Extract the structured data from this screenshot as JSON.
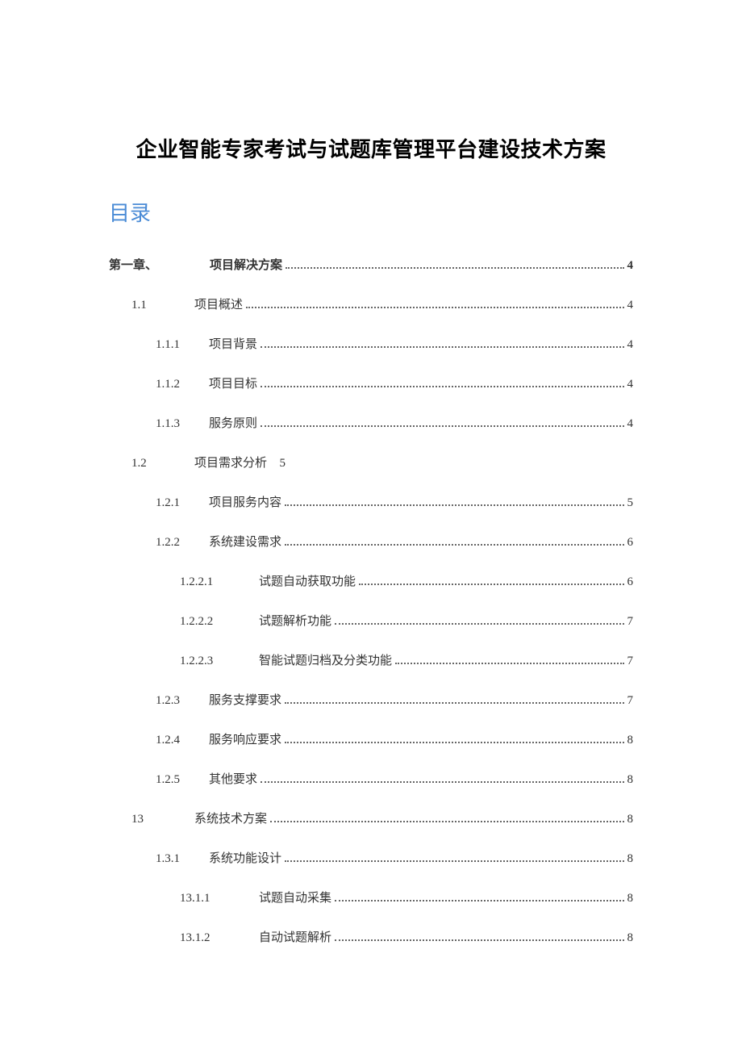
{
  "title": "企业智能专家考试与试题库管理平台建设技术方案",
  "toc_heading": "目录",
  "toc": [
    {
      "level": 1,
      "num": "第一章、",
      "label": "项目解决方案",
      "page": "4",
      "dots": true
    },
    {
      "level": 2,
      "num": "1.1",
      "label": "项目概述",
      "page": "4",
      "dots": true
    },
    {
      "level": 3,
      "num": "1.1.1",
      "label": "项目背景",
      "page": "4",
      "dots": true
    },
    {
      "level": 3,
      "num": "1.1.2",
      "label": "项目目标",
      "page": "4",
      "dots": true
    },
    {
      "level": 3,
      "num": "1.1.3",
      "label": "服务原则",
      "page": "4",
      "dots": true
    },
    {
      "level": 2,
      "num": "1.2",
      "label": "项目需求分析",
      "page": "5",
      "dots": false
    },
    {
      "level": 3,
      "num": "1.2.1",
      "label": "项目服务内容",
      "page": "5",
      "dots": true
    },
    {
      "level": 3,
      "num": "1.2.2",
      "label": "系统建设需求",
      "page": "6",
      "dots": true
    },
    {
      "level": 4,
      "num": "1.2.2.1",
      "label": "试题自动获取功能",
      "page": "6",
      "dots": true
    },
    {
      "level": 4,
      "num": "1.2.2.2",
      "label": "试题解析功能",
      "page": "7",
      "dots": true
    },
    {
      "level": 4,
      "num": "1.2.2.3",
      "label": "智能试题归档及分类功能",
      "page": "7",
      "dots": true
    },
    {
      "level": 3,
      "num": "1.2.3",
      "label": "服务支撑要求",
      "page": "7",
      "dots": true
    },
    {
      "level": 3,
      "num": "1.2.4",
      "label": "服务响应要求",
      "page": "8",
      "dots": true
    },
    {
      "level": 3,
      "num": "1.2.5",
      "label": "其他要求",
      "page": "8",
      "dots": true
    },
    {
      "level": 2,
      "num": "13",
      "label": "系统技术方案",
      "page": "8",
      "dots": true
    },
    {
      "level": 3,
      "num": "1.3.1",
      "label": "系统功能设计",
      "page": "8",
      "dots": true
    },
    {
      "level": 4,
      "num": "13.1.1",
      "label": "试题自动采集",
      "page": "8",
      "dots": true
    },
    {
      "level": 4,
      "num": "13.1.2",
      "label": "自动试题解析",
      "page": "8",
      "dots": true
    }
  ]
}
